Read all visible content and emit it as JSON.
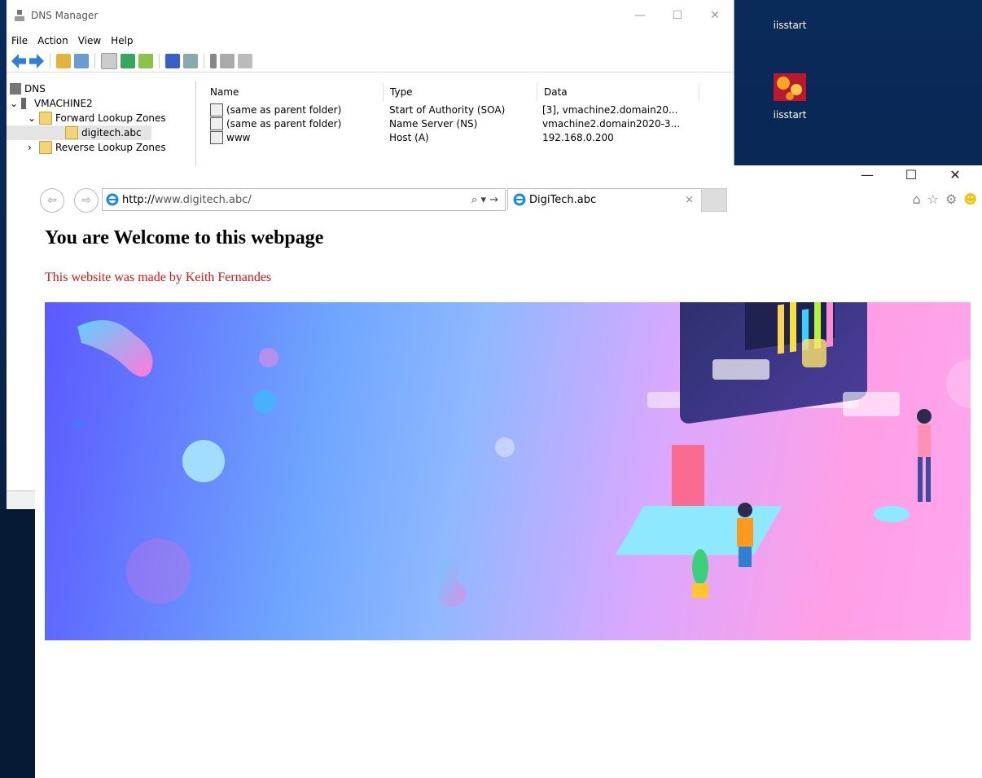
{
  "desktop": {
    "icons": [
      {
        "label": "iisstart",
        "icon": "ie-shortcut-icon"
      },
      {
        "label": "iisstart",
        "icon": "flower-image-icon"
      }
    ]
  },
  "dns_manager": {
    "title": "DNS Manager",
    "menu": [
      "File",
      "Action",
      "View",
      "Help"
    ],
    "tree": [
      {
        "label": "DNS",
        "level": 0
      },
      {
        "label": "VMACHINE2",
        "level": 1
      },
      {
        "label": "Forward Lookup Zones",
        "level": 2
      },
      {
        "label": "digitech.abc",
        "level": 3,
        "selected": true
      },
      {
        "label": "Reverse Lookup Zones",
        "level": 2
      }
    ],
    "columns": [
      "Name",
      "Type",
      "Data"
    ],
    "records": [
      {
        "name": "(same as parent folder)",
        "type": "Start of Authority (SOA)",
        "data": "[3], vmachine2.domain20..."
      },
      {
        "name": "(same as parent folder)",
        "type": "Name Server (NS)",
        "data": "vmachine2.domain2020-3..."
      },
      {
        "name": "www",
        "type": "Host (A)",
        "data": "192.168.0.200"
      }
    ]
  },
  "browser": {
    "url_scheme": "http://",
    "url_rest": "www.digitech.abc/",
    "tab_title": "DigiTech.abc",
    "search_glyph": "⌕ ▾ →",
    "close_glyph": "×",
    "page": {
      "heading": "You are Welcome to this webpage",
      "subtitle": "This website was made by Keith Fernandes"
    },
    "colors": {
      "subtitle": "#d21414",
      "banner_start": "#5b59ff",
      "banner_end": "#ffa6ee"
    }
  }
}
